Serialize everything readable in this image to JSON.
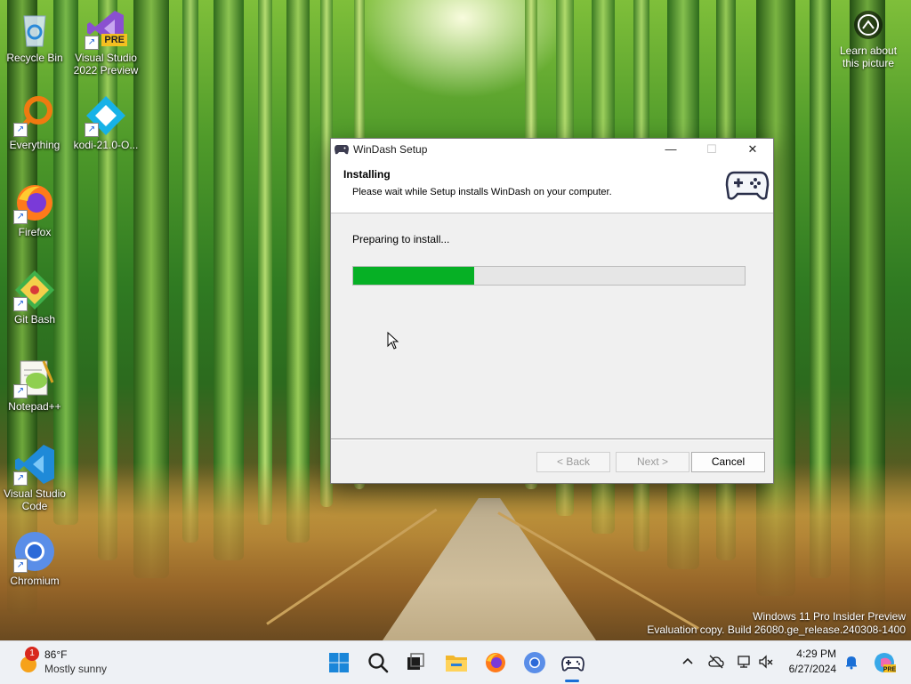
{
  "desktop": {
    "icons": [
      {
        "label": "Recycle Bin",
        "icon": "recycle-bin-icon"
      },
      {
        "label": "Visual Studio 2022 Preview",
        "icon": "visual-studio-preview-icon",
        "badge": "PRE"
      },
      {
        "label": "Everything",
        "icon": "everything-search-icon"
      },
      {
        "label": "kodi-21.0-O...",
        "icon": "kodi-icon"
      },
      {
        "label": "Firefox",
        "icon": "firefox-icon"
      },
      {
        "label": "Git Bash",
        "icon": "git-bash-icon"
      },
      {
        "label": "Notepad++",
        "icon": "notepad-plus-plus-icon"
      },
      {
        "label": "Visual Studio Code",
        "icon": "vscode-icon"
      },
      {
        "label": "Chromium",
        "icon": "chromium-icon"
      }
    ],
    "learn_about": {
      "line1": "Learn about",
      "line2": "this picture"
    },
    "watermark": {
      "line1": "Windows 11 Pro Insider Preview",
      "line2": "Evaluation copy. Build 26080.ge_release.240308-1400"
    }
  },
  "setup_window": {
    "title": "WinDash Setup",
    "controls": {
      "minimize": "—",
      "maximize": "☐",
      "close": "✕"
    },
    "header": {
      "title": "Installing",
      "subtitle": "Please wait while Setup installs WinDash on your computer."
    },
    "status_text": "Preparing to install...",
    "progress_fraction": 0.31,
    "buttons": {
      "back": "< Back",
      "next": "Next >",
      "cancel": "Cancel"
    },
    "colors": {
      "progress": "#06b025"
    }
  },
  "taskbar": {
    "weather": {
      "temp": "86°F",
      "desc": "Mostly sunny",
      "alert_count": "1"
    },
    "pinned": [
      "windows-start-icon",
      "search-icon",
      "task-view-icon",
      "file-explorer-icon",
      "firefox-icon",
      "chromium-icon",
      "windash-gamepad-icon"
    ],
    "tray": [
      "chevron-up-icon",
      "onedrive-offline-icon",
      "network-icon",
      "volume-icon"
    ],
    "time": "4:29 PM",
    "date": "6/27/2024"
  }
}
